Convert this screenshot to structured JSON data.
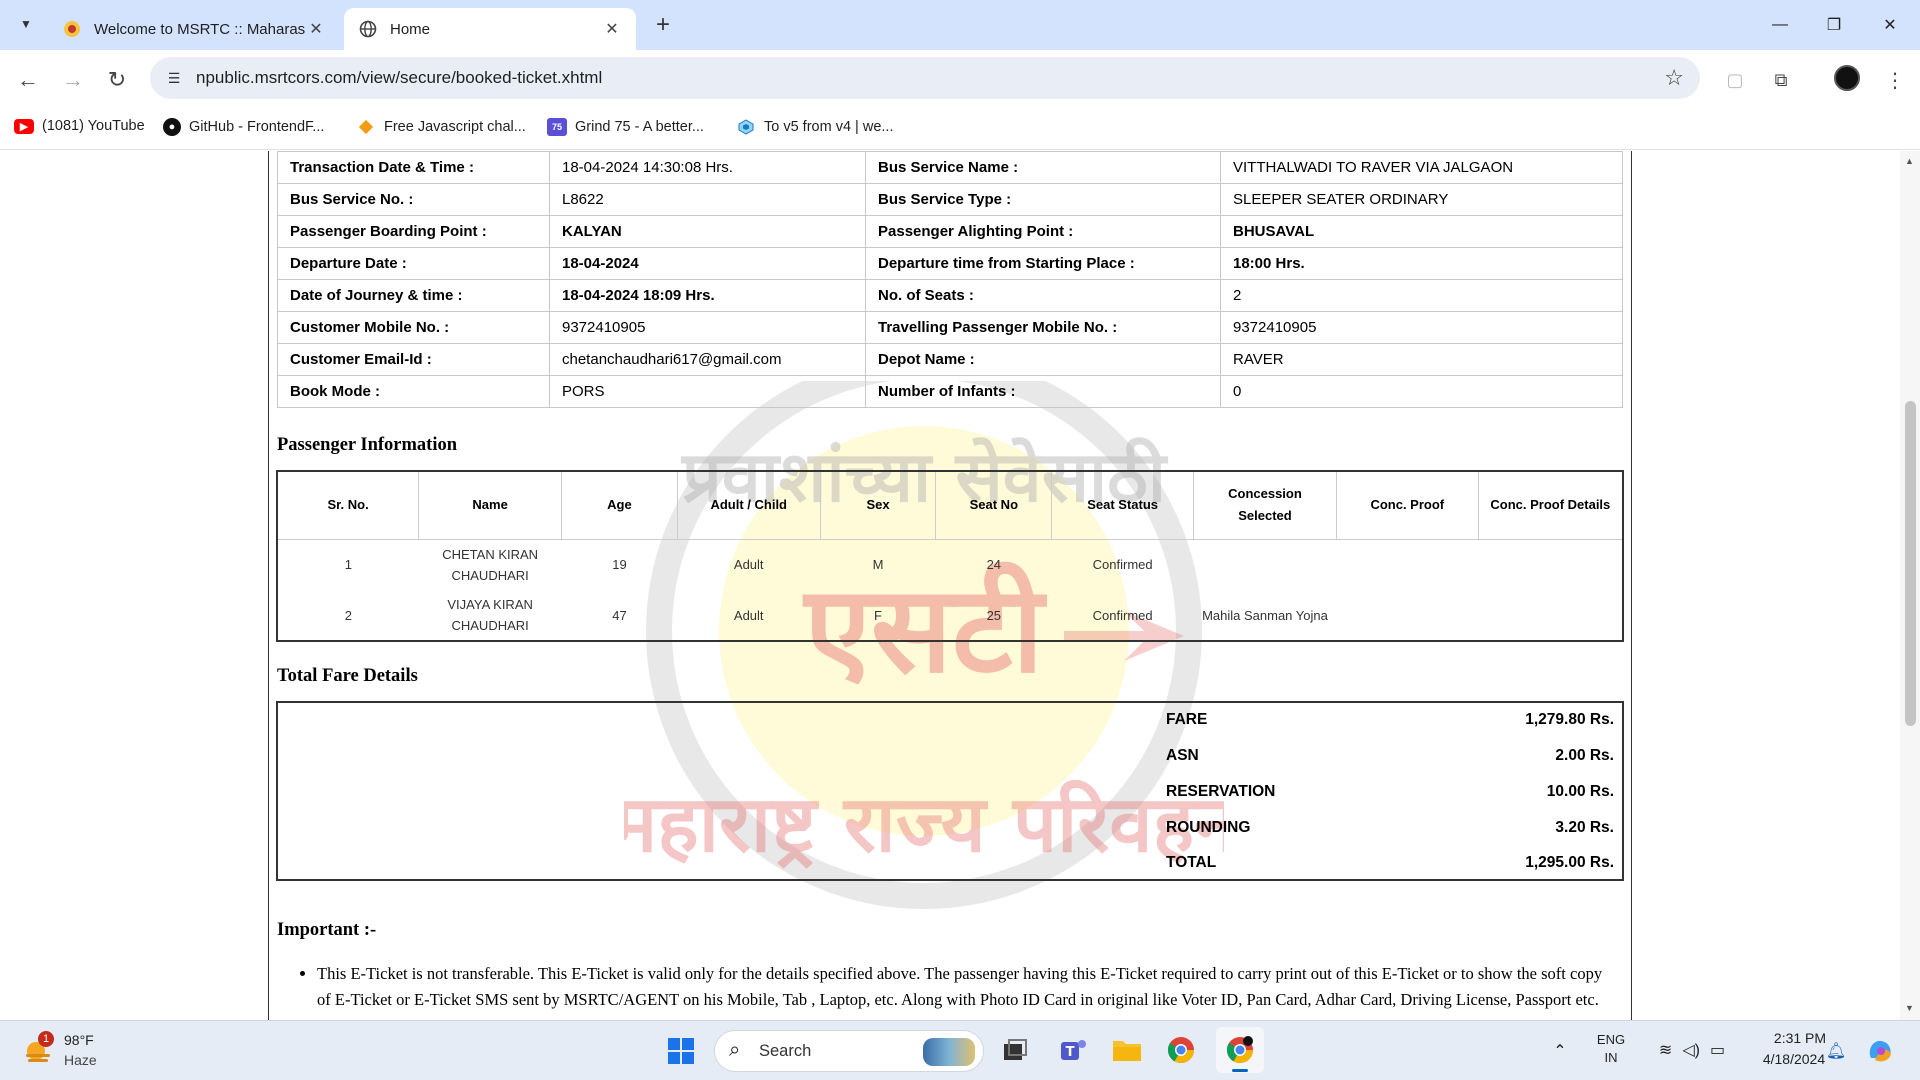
{
  "browser": {
    "tabs": [
      {
        "title": "Welcome to MSRTC :: Maharashtra",
        "favicon": "msrtc-logo-icon"
      },
      {
        "title": "Home",
        "favicon": "globe-icon"
      }
    ],
    "url": "npublic.msrtcors.com/view/secure/booked-ticket.xhtml",
    "bookmarks": [
      {
        "label": "(1081) YouTube",
        "icon": "youtube-icon"
      },
      {
        "label": "GitHub - FrontendF...",
        "icon": "github-icon"
      },
      {
        "label": "Free Javascript chal...",
        "icon": "diamond-icon"
      },
      {
        "label": "Grind 75 - A better...",
        "icon": "grind75-icon",
        "icon_text": "75"
      },
      {
        "label": "To v5 from v4 | we...",
        "icon": "webpack-icon"
      }
    ]
  },
  "ticket": {
    "details": [
      {
        "l1": "Transaction Date & Time :",
        "v1": "18-04-2024 14:30:08 Hrs.",
        "l2": "Bus Service Name :",
        "v2": "VITTHALWADI TO RAVER VIA JALGAON"
      },
      {
        "l1": "Bus Service No. :",
        "v1": "L8622",
        "l2": "Bus Service Type :",
        "v2": "SLEEPER SEATER ORDINARY"
      },
      {
        "l1": "Passenger Boarding Point :",
        "v1": "KALYAN",
        "l2": "Passenger Alighting Point :",
        "v2": "BHUSAVAL"
      },
      {
        "l1": "Departure Date :",
        "v1": "18-04-2024",
        "l2": "Departure time from Starting Place :",
        "v2": "18:00 Hrs."
      },
      {
        "l1": "Date of Journey & time :",
        "v1": "18-04-2024 18:09 Hrs.",
        "l2": "No. of Seats :",
        "v2": "2"
      },
      {
        "l1": "Customer Mobile No. :",
        "v1": "9372410905",
        "l2": "Travelling Passenger Mobile No. :",
        "v2": "9372410905"
      },
      {
        "l1": "Customer Email-Id :",
        "v1": "chetanchaudhari617@gmail.com",
        "l2": "Depot Name :",
        "v2": "RAVER"
      },
      {
        "l1": "Book Mode :",
        "v1": "PORS",
        "l2": "Number of Infants :",
        "v2": "0"
      }
    ],
    "passenger_title": "Passenger Information",
    "passenger_headers": [
      "Sr. No.",
      "Name",
      "Age",
      "Adult / Child",
      "Sex",
      "Seat No",
      "Seat Status",
      "Concession Selected",
      "Conc. Proof",
      "Conc. Proof Details"
    ],
    "passengers": [
      {
        "sr": "1",
        "name": "CHETAN KIRAN CHAUDHARI",
        "age": "19",
        "type": "Adult",
        "sex": "M",
        "seat": "24",
        "status": "Confirmed",
        "concession": "",
        "proof": "",
        "proof_details": ""
      },
      {
        "sr": "2",
        "name": "VIJAYA KIRAN CHAUDHARI",
        "age": "47",
        "type": "Adult",
        "sex": "F",
        "seat": "25",
        "status": "Confirmed",
        "concession": "Mahila Sanman Yojna",
        "proof": "",
        "proof_details": ""
      }
    ],
    "fare_title": "Total Fare Details",
    "fares": [
      {
        "label": "FARE",
        "amount": "1,279.80 Rs."
      },
      {
        "label": "ASN",
        "amount": "2.00 Rs."
      },
      {
        "label": "RESERVATION",
        "amount": "10.00 Rs."
      },
      {
        "label": "ROUNDING",
        "amount": "3.20 Rs."
      },
      {
        "label": "TOTAL",
        "amount": "1,295.00 Rs."
      }
    ],
    "important_title": "Important :-",
    "important_items": [
      "This E-Ticket is not transferable. This E-Ticket is valid only for the details specified above. The passenger having this E-Ticket required to carry print out of this E-Ticket or to show the soft copy of E-Ticket or E-Ticket SMS sent by MSRTC/AGENT on his Mobile, Tab , Laptop, etc. Along with Photo ID Card in original like Voter ID, Pan Card, Adhar Card, Driving License, Passport etc."
    ],
    "watermark": {
      "top_text": "प्रवाशांच्या सेवेसाठी",
      "mid_text": "एसटी",
      "bottom_text": "महाराष्ट्र राज्य परिवहन"
    }
  },
  "taskbar": {
    "weather": {
      "temp": "98°F",
      "desc": "Haze",
      "badge": "1"
    },
    "search_placeholder": "Search",
    "lang": {
      "line1": "ENG",
      "line2": "IN"
    },
    "time": "2:31 PM",
    "date": "4/18/2024"
  }
}
